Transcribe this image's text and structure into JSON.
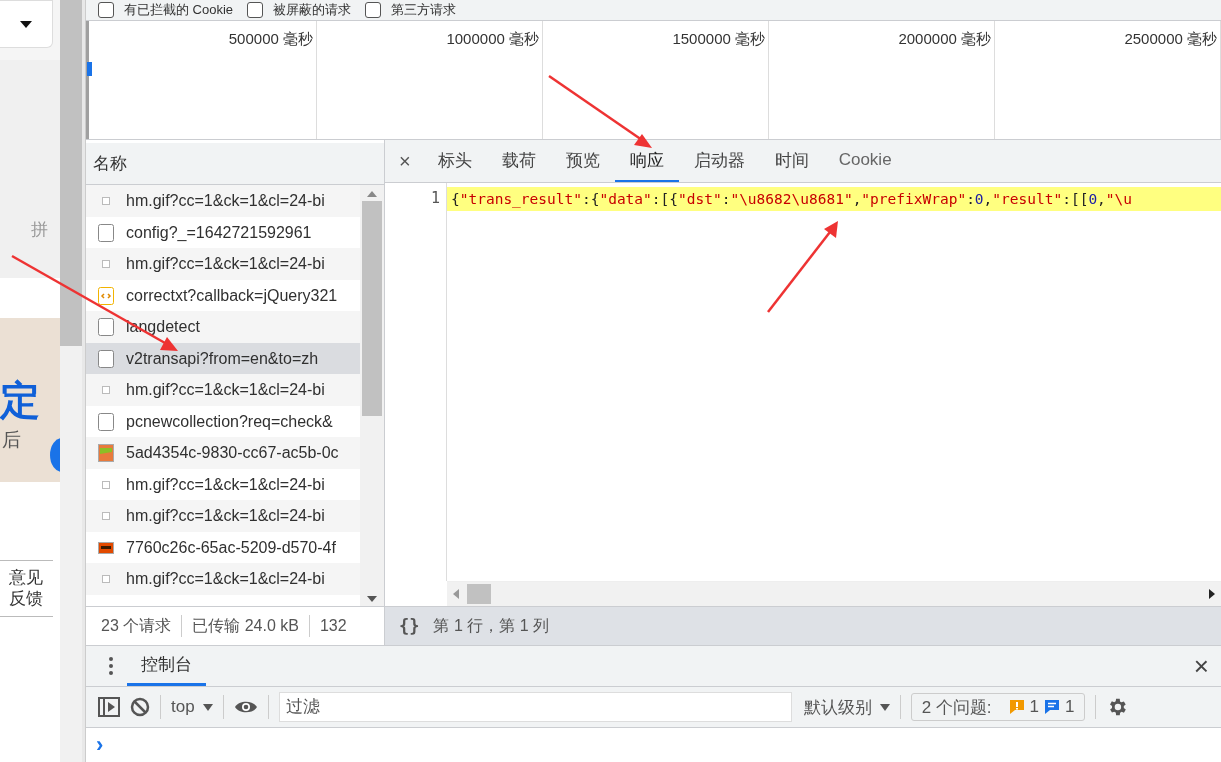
{
  "site": {
    "side_text": "拼",
    "banner_lines": [
      "定",
      "后"
    ],
    "feedback": "意见反馈"
  },
  "filters": [
    {
      "label": "有已拦截的 Cookie",
      "checked": false
    },
    {
      "label": "被屏蔽的请求",
      "checked": false
    },
    {
      "label": "第三方请求",
      "checked": false
    }
  ],
  "timeline": {
    "ticks": [
      "500000 毫秒",
      "1000000 毫秒",
      "1500000 毫秒",
      "2000000 毫秒",
      "2500000 毫秒"
    ]
  },
  "requests": {
    "column": "名称",
    "rows": [
      {
        "name": "hm.gif?cc=1&ck=1&cl=24-bi",
        "kind": "gif",
        "selected": false
      },
      {
        "name": "config?_=1642721592961",
        "kind": "doc",
        "selected": false
      },
      {
        "name": "hm.gif?cc=1&ck=1&cl=24-bi",
        "kind": "gif",
        "selected": false
      },
      {
        "name": "correctxt?callback=jQuery321",
        "kind": "script",
        "selected": false
      },
      {
        "name": "langdetect",
        "kind": "doc",
        "selected": false
      },
      {
        "name": "v2transapi?from=en&to=zh",
        "kind": "doc",
        "selected": true
      },
      {
        "name": "hm.gif?cc=1&ck=1&cl=24-bi",
        "kind": "gif",
        "selected": false
      },
      {
        "name": "pcnewcollection?req=check&",
        "kind": "doc",
        "selected": false
      },
      {
        "name": "5ad4354c-9830-cc67-ac5b-0c",
        "kind": "image",
        "selected": false
      },
      {
        "name": "hm.gif?cc=1&ck=1&cl=24-bi",
        "kind": "gif",
        "selected": false
      },
      {
        "name": "hm.gif?cc=1&ck=1&cl=24-bi",
        "kind": "gif",
        "selected": false
      },
      {
        "name": "7760c26c-65ac-5209-d570-4f",
        "kind": "banner",
        "selected": false
      },
      {
        "name": "hm.gif?cc=1&ck=1&cl=24-bi",
        "kind": "gif",
        "selected": false
      }
    ],
    "summary": [
      "23 个请求",
      "已传输 24.0 kB",
      "132"
    ]
  },
  "detail": {
    "close": "×",
    "tabs": [
      {
        "label": "标头",
        "selected": false
      },
      {
        "label": "载荷",
        "selected": false
      },
      {
        "label": "预览",
        "selected": false
      },
      {
        "label": "响应",
        "selected": true
      },
      {
        "label": "启动器",
        "selected": false
      },
      {
        "label": "时间",
        "selected": false
      },
      {
        "label": "Cookie",
        "selected": false
      }
    ],
    "line_number": "1",
    "tokens": [
      {
        "kind": "punct",
        "text": "{"
      },
      {
        "kind": "string",
        "text": "\"trans_result\""
      },
      {
        "kind": "punct",
        "text": ":{"
      },
      {
        "kind": "string",
        "text": "\"data\""
      },
      {
        "kind": "punct",
        "text": ":[{"
      },
      {
        "kind": "string",
        "text": "\"dst\""
      },
      {
        "kind": "punct",
        "text": ":"
      },
      {
        "kind": "string",
        "text": "\"\\u8682\\u8681\""
      },
      {
        "kind": "punct",
        "text": ","
      },
      {
        "kind": "string",
        "text": "\"prefixWrap\""
      },
      {
        "kind": "punct",
        "text": ":"
      },
      {
        "kind": "number",
        "text": "0"
      },
      {
        "kind": "punct",
        "text": ","
      },
      {
        "kind": "string",
        "text": "\"result\""
      },
      {
        "kind": "punct",
        "text": ":[["
      },
      {
        "kind": "number",
        "text": "0"
      },
      {
        "kind": "punct",
        "text": ","
      },
      {
        "kind": "string",
        "text": "\"\\u"
      }
    ],
    "format": "{}",
    "position": "第 1 行，第 1 列"
  },
  "drawer": {
    "tabs": [
      {
        "label": "控制台",
        "selected": true
      }
    ],
    "close": "×",
    "context": "top",
    "filter_placeholder": "过滤",
    "level": "默认级别",
    "issues": {
      "label": "2 个问题:",
      "warnings": "1",
      "infos": "1"
    },
    "prompt": "›"
  }
}
